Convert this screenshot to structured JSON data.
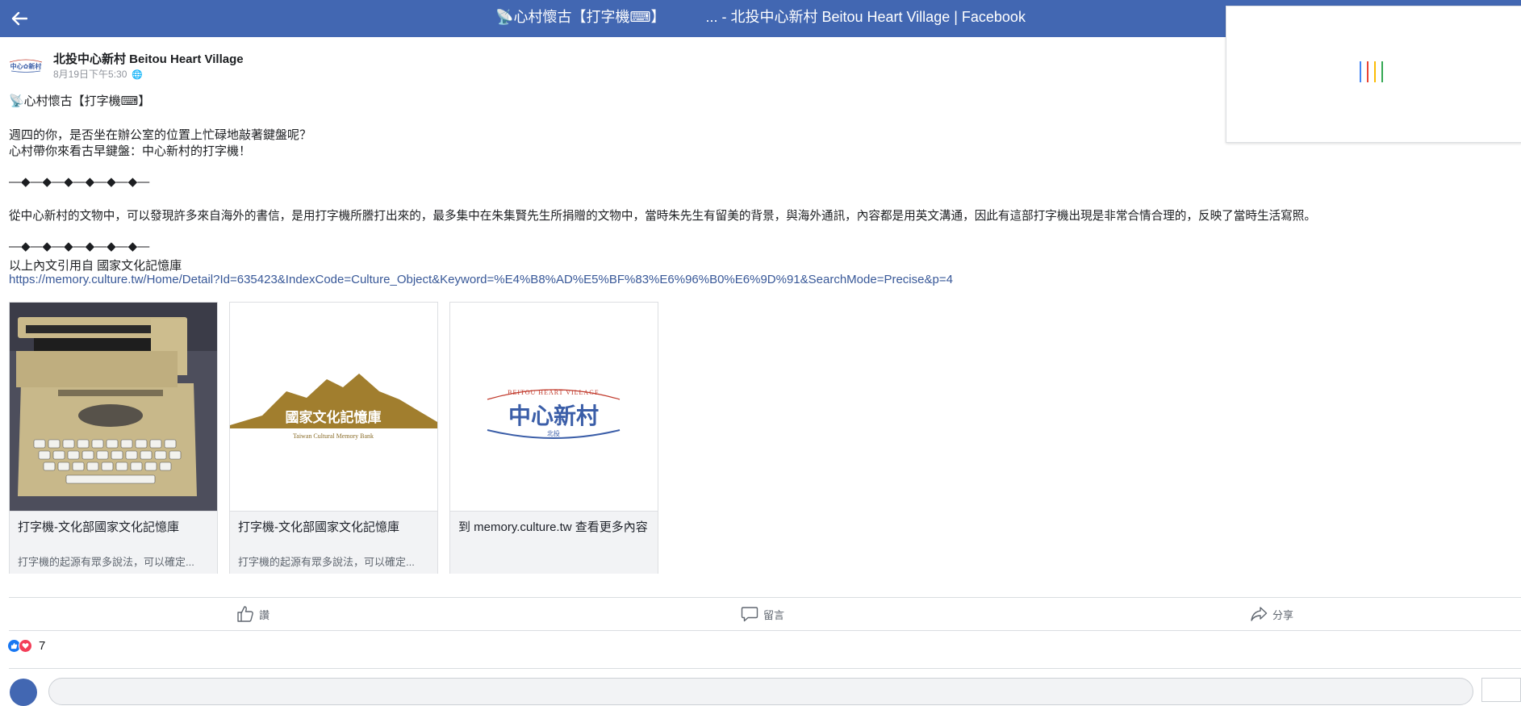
{
  "topbar": {
    "title": "📡心村懷古【打字機⌨】          ... - 北投中心新村 Beitou Heart Village | Facebook",
    "loader_colors": [
      "#4285f4",
      "#ea4335",
      "#fbbc05",
      "#34a853"
    ]
  },
  "post": {
    "page_name": "北投中心新村 Beitou Heart Village",
    "timestamp": "8月19日下午5:30",
    "logo_text": "中心新村",
    "lines": [
      "📡心村懷古【打字機⌨】",
      "週四的你，是否坐在辦公室的位置上忙碌地敲著鍵盤呢？",
      "心村帶你來看古早鍵盤：中心新村的打字機！",
      "—◆—◆—◆—◆—◆—◆—",
      "從中心新村的文物中，可以發現許多來自海外的書信，是用打字機所謄打出來的，最多集中在朱集賢先生所捐贈的文物中，當時朱先生有留美的背景，與海外通訊，內容都是用英文溝通，因此有這部打字機出現是非常合情合理的，反映了當時生活寫照。",
      "—◆—◆—◆—◆—◆—◆—",
      "以上內文引用自 國家文化記憶庫"
    ],
    "link": "https://memory.culture.tw/Home/Detail?Id=635423&IndexCode=Culture_Object&Keyword=%E4%B8%AD%E5%BF%83%E6%96%B0%E6%9D%91&SearchMode=Precise&p=4"
  },
  "cards": [
    {
      "title": "打字機-文化部國家文化記憶庫",
      "desc": "打字機的起源有眾多說法，可以確定..."
    },
    {
      "title": "打字機-文化部國家文化記憶庫",
      "desc": "打字機的起源有眾多說法，可以確定...",
      "logo_text": "國家文化記憶庫",
      "logo_sub": "Taiwan Cultural Memory Bank"
    },
    {
      "title": "到 memory.culture.tw 查看更多內容",
      "logo_top": "BEITOU HEART VILLAGE",
      "logo_text": "中心新村",
      "logo_sub": "北投"
    }
  ],
  "actions": {
    "like": "讚",
    "comment": "留言",
    "share": "分享"
  },
  "reactions": {
    "count": "7",
    "colors": {
      "like": "#1877f2",
      "love": "#f33e58"
    }
  },
  "colors": {
    "brand": "#4267b2",
    "link": "#385898"
  }
}
